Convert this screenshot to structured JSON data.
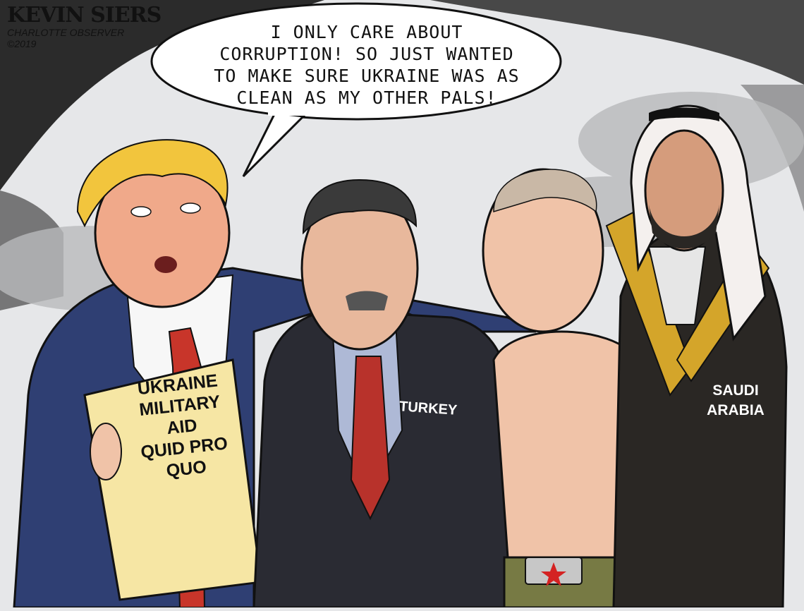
{
  "signature": {
    "artist": "KEVIN SIERS",
    "publication": "CHARLOTTE OBSERVER",
    "copyright": "©2019"
  },
  "speech_bubble": {
    "lines": [
      "I ONLY CARE ABOUT",
      "CORRUPTION! SO JUST WANTED",
      "TO MAKE SURE UKRAINE WAS AS",
      "CLEAN AS MY OTHER PALS!"
    ]
  },
  "sign": {
    "lines": [
      "UKRAINE",
      "MILITARY",
      "AID",
      "QUID PRO",
      "QUO"
    ]
  },
  "labels": {
    "turkey": "TURKEY",
    "saudi_line1": "SAUDI",
    "saudi_line2": "ARABIA"
  },
  "colors": {
    "background": "#e6e7e9",
    "sky_shadow": "#2b2b2b",
    "suit_blue": "#2f3f73",
    "suit_dark": "#2a2b33",
    "tie_red": "#c8352a",
    "sign_paper": "#f6e6a4",
    "skin": "#f0c3a8",
    "hair_gold": "#f2c53d",
    "robe_black": "#2a2724",
    "robe_gold": "#d4a52a",
    "keffiyeh_red": "#c83a3a",
    "pants_olive": "#777a44",
    "star_red": "#d42222"
  }
}
